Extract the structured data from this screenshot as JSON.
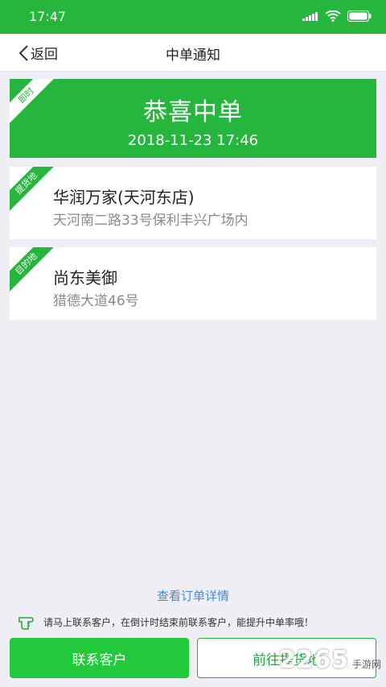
{
  "status": {
    "time": "17:47"
  },
  "nav": {
    "back_label": "返回",
    "title": "中单通知"
  },
  "hero": {
    "ribbon": "即时",
    "title": "恭喜中单",
    "datetime": "2018-11-23 17:46"
  },
  "pickup": {
    "ribbon": "提货地",
    "name": "华润万家(天河东店)",
    "address": "天河南二路33号保利丰兴广场内"
  },
  "destination": {
    "ribbon": "目的地",
    "name": "尚东美御",
    "address": "猎德大道46号"
  },
  "footer": {
    "detail_link": "查看订单详情",
    "tip": "请马上联系客户，在倒计时结束前联系客户，能提升中单率哦！",
    "contact_button": "联系客户",
    "pickup_button": "前往提货地"
  },
  "watermark": {
    "number": "2265",
    "text": "手游网"
  },
  "colors": {
    "accent": "#26b53d",
    "link": "#3d8ee0"
  }
}
